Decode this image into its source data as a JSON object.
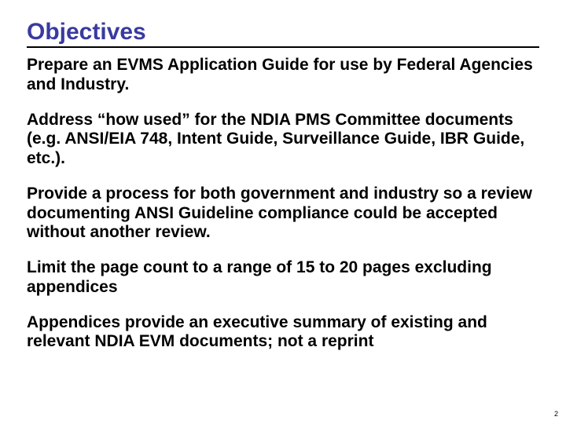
{
  "title": "Objectives",
  "paragraphs": [
    "Prepare an EVMS Application Guide for use by Federal Agencies and Industry.",
    "Address “how used” for the NDIA PMS Committee documents (e.g. ANSI/EIA 748, Intent Guide, Surveillance Guide, IBR Guide, etc.).",
    "Provide a process for both government and industry so a review documenting ANSI Guideline compliance could be accepted without another review.",
    "Limit the page count to a range of 15 to 20 pages excluding appendices",
    "Appendices provide an executive summary of existing and relevant NDIA EVM documents; not a reprint"
  ],
  "page_number": "2"
}
